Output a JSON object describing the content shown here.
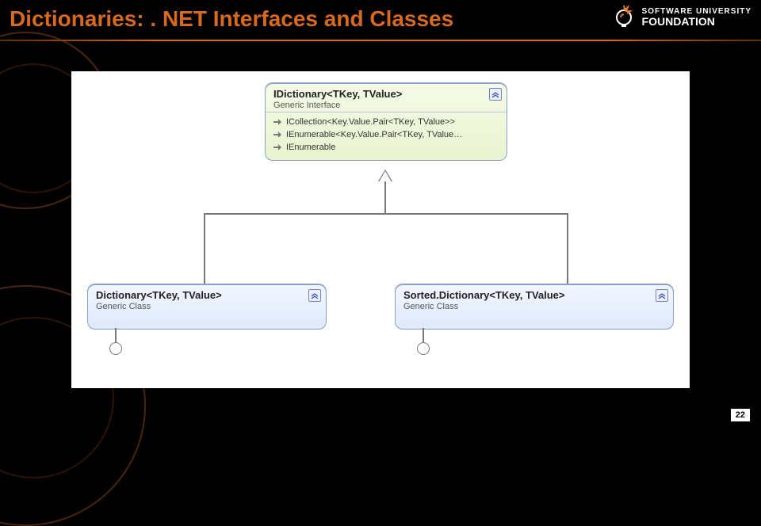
{
  "slide": {
    "title": "Dictionaries: . NET Interfaces and Classes",
    "page_number": "22",
    "brand_line1": "SOFTWARE UNIVERSITY",
    "brand_line2": "FOUNDATION"
  },
  "diagram": {
    "interface": {
      "title": "IDictionary<TKey, TValue>",
      "subtitle": "Generic Interface",
      "members": [
        "ICollection<Key.Value.Pair<TKey, TValue>>",
        "IEnumerable<Key.Value.Pair<TKey, TValue…",
        "IEnumerable"
      ]
    },
    "class_left": {
      "title": "Dictionary<TKey, TValue>",
      "subtitle": "Generic Class"
    },
    "class_right": {
      "title": "Sorted.Dictionary<TKey, TValue>",
      "subtitle": "Generic Class"
    }
  }
}
